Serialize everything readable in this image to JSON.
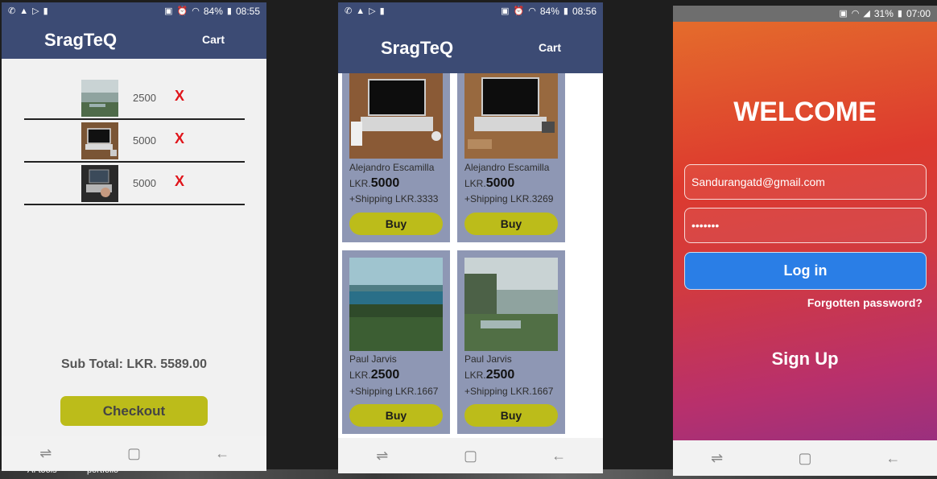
{
  "taskbar": {
    "items": [
      "AI tools",
      "portfolio"
    ]
  },
  "cart_screen": {
    "status": {
      "battery": "84%",
      "time": "08:55"
    },
    "app_title": "SragTeQ",
    "cart_label": "Cart",
    "items": [
      {
        "price": "2500",
        "remove": "X"
      },
      {
        "price": "5000",
        "remove": "X"
      },
      {
        "price": "5000",
        "remove": "X"
      }
    ],
    "subtotal": "Sub Total: LKR. 5589.00",
    "checkout_label": "Checkout"
  },
  "shop_screen": {
    "status": {
      "battery": "84%",
      "time": "08:56"
    },
    "app_title": "SragTeQ",
    "cart_label": "Cart",
    "products": [
      {
        "author": "Alejandro Escamilla",
        "currency": "LKR.",
        "price": "5000",
        "shipping": "+Shipping LKR.3333",
        "buy": "Buy"
      },
      {
        "author": "Alejandro Escamilla",
        "currency": "LKR.",
        "price": "5000",
        "shipping": "+Shipping LKR.3269",
        "buy": "Buy"
      },
      {
        "author": "Paul Jarvis",
        "currency": "LKR.",
        "price": "2500",
        "shipping": "+Shipping LKR.1667",
        "buy": "Buy"
      },
      {
        "author": "Paul Jarvis",
        "currency": "LKR.",
        "price": "2500",
        "shipping": "+Shipping LKR.1667",
        "buy": "Buy"
      }
    ]
  },
  "login_screen": {
    "status": {
      "battery": "31%",
      "time": "07:00"
    },
    "welcome": "WELCOME",
    "email_value": "Sandurangatd@gmail.com",
    "password_value": "•••••••",
    "login_label": "Log in",
    "forgot_label": "Forgotten password?",
    "signup_label": "Sign Up"
  }
}
